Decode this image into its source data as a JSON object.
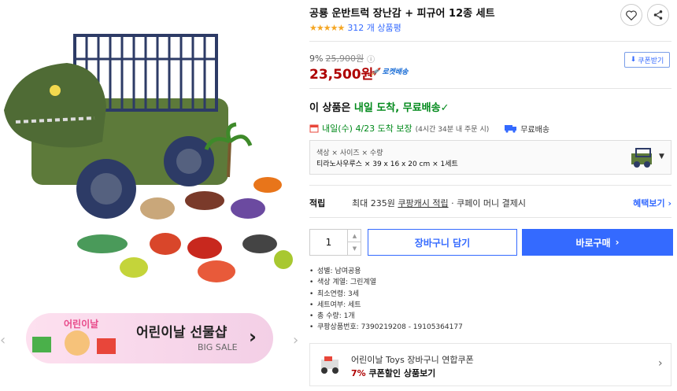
{
  "gallery": {
    "prev_icon": "chevron-left",
    "next_icon": "chevron-right",
    "banner_brand": "어린이날",
    "banner_title": "어린이날 선물샵",
    "banner_subtitle": "BIG SALE"
  },
  "product": {
    "title": "공룡 운반트럭 장난감 + 피규어 12종 세트",
    "rating": 4.5,
    "review_count": "312 개 상품평",
    "discount_rate": "9%",
    "original_price": "25,900원",
    "price": "23,500원",
    "rocket_label": "로켓배송",
    "coupon_label": "쿠폰받기"
  },
  "delivery": {
    "prefix": "이 상품은 ",
    "highlight": "내일 도착, 무료배송",
    "date": "내일(수) 4/23 도착 보장",
    "cutoff": "(4시간 34분 내 주문 시)",
    "free_shipping": "무료배송"
  },
  "option": {
    "label": "색상 × 사이즈 × 수량",
    "value": "티라노사우루스 × 39 x 16 x 20 cm × 1세트"
  },
  "points": {
    "label": "적립",
    "text_a": "최대 235원 ",
    "text_link": "쿠팡캐시 적립",
    "text_b": " · 쿠페이 머니 결제시",
    "benefits": "혜택보기"
  },
  "purchase": {
    "quantity": "1",
    "cart_label": "장바구니 담기",
    "buy_label": "바로구매"
  },
  "attributes": [
    "성별: 남여공용",
    "색상 계열: 그린계열",
    "최소연령: 3세",
    "세트여부: 세트",
    "총 수량: 1개",
    "쿠팡상품번호: 7390219208 - 19105364177"
  ],
  "promo": {
    "line1": "어린이날 Toys 장바구니 연합쿠폰",
    "rate": "7%",
    "line2": " 쿠폰할인 상품보기"
  },
  "colors": {
    "accent_blue": "#346aff",
    "price_red": "#ae0000",
    "delivery_green": "#00891a",
    "star": "#f5a623"
  }
}
